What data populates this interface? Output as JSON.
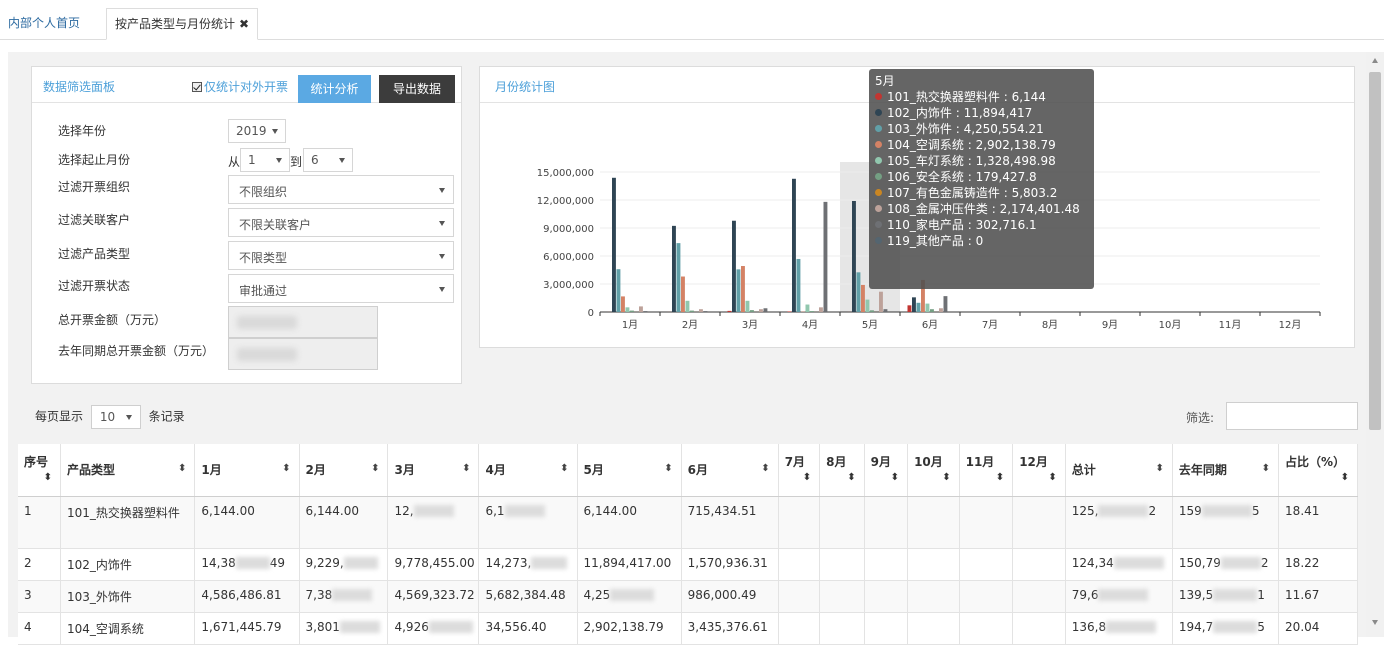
{
  "tabs": [
    {
      "label": "内部个人首页",
      "active": false
    },
    {
      "label": "按产品类型与月份统计",
      "active": true,
      "close_glyph": "✖"
    }
  ],
  "filter_panel": {
    "title": "数据筛选面板",
    "only_external_label": "仅统计对外开票",
    "only_external_checked": true,
    "analyze_button": "统计分析",
    "export_button": "导出数据",
    "labels": {
      "year": "选择年份",
      "month_range": "选择起止月份",
      "org": "过滤开票组织",
      "customer": "过滤关联客户",
      "product_type": "过滤产品类型",
      "status": "过滤开票状态",
      "total": "总开票金额（万元）",
      "last_year": "去年同期总开票金额（万元）"
    },
    "year_value": "2019",
    "month_from_prefix": "从",
    "month_from": "1",
    "month_to_prefix": "到",
    "month_to": "6",
    "org_value": "不限组织",
    "customer_value": "不限关联客户",
    "product_type_value": "不限类型",
    "status_value": "审批通过"
  },
  "chart_panel": {
    "title": "月份统计图"
  },
  "chart_data": {
    "type": "bar",
    "categories": [
      "1月",
      "2月",
      "3月",
      "4月",
      "5月",
      "6月",
      "7月",
      "8月",
      "9月",
      "10月",
      "11月",
      "12月"
    ],
    "series": [
      {
        "name": "101_热交换器塑料件",
        "color": "#c23531",
        "values": [
          6144,
          6144,
          120000,
          61000,
          6144,
          715434.51,
          0,
          0,
          0,
          0,
          0,
          0
        ]
      },
      {
        "name": "102_内饰件",
        "color": "#2f4554",
        "values": [
          14380000,
          9229000,
          9778455,
          14273000,
          11894417,
          1570936.31,
          0,
          0,
          0,
          0,
          0,
          0
        ]
      },
      {
        "name": "103_外饰件",
        "color": "#61a0a8",
        "values": [
          4586486.81,
          7380000,
          4569323.72,
          5682384.48,
          4250554.21,
          986000.49,
          0,
          0,
          0,
          0,
          0,
          0
        ]
      },
      {
        "name": "104_空调系统",
        "color": "#d48265",
        "values": [
          1671445.79,
          3801000,
          4926000,
          34556.4,
          2902138.79,
          3435376.61,
          0,
          0,
          0,
          0,
          0,
          0
        ]
      },
      {
        "name": "105_车灯系统",
        "color": "#91c7ae",
        "values": [
          500000,
          1200000,
          1200000,
          800000,
          1328498.98,
          900000,
          0,
          0,
          0,
          0,
          0,
          0
        ]
      },
      {
        "name": "106_安全系统",
        "color": "#749f83",
        "values": [
          150000,
          150000,
          200000,
          100000,
          179427.8,
          300000,
          0,
          0,
          0,
          0,
          0,
          0
        ]
      },
      {
        "name": "107_有色金属铸造件",
        "color": "#ca8622",
        "values": [
          5000,
          5000,
          5000,
          5000,
          5803.2,
          5000,
          0,
          0,
          0,
          0,
          0,
          0
        ]
      },
      {
        "name": "108_金属冲压件类",
        "color": "#bda29a",
        "values": [
          600000,
          300000,
          300000,
          500000,
          2174401.48,
          400000,
          0,
          0,
          0,
          0,
          0,
          0
        ]
      },
      {
        "name": "110_家电产品",
        "color": "#6e7074",
        "values": [
          100000,
          100000,
          400000,
          11800000,
          302716.1,
          1700000,
          0,
          0,
          0,
          0,
          0,
          0
        ]
      },
      {
        "name": "119_其他产品",
        "color": "#546570",
        "values": [
          0,
          0,
          0,
          0,
          0,
          0,
          0,
          0,
          0,
          0,
          0,
          0
        ]
      }
    ],
    "y_ticks": [
      "0",
      "3,000,000",
      "6,000,000",
      "9,000,000",
      "12,000,000",
      "15,000,000"
    ],
    "ylim": [
      0,
      15000000
    ],
    "grid": true,
    "highlighted_category": "5月",
    "tooltip": {
      "title": "5月",
      "rows": [
        {
          "text": "101_热交换器塑料件 : 6,144",
          "color": "#c23531"
        },
        {
          "text": "102_内饰件 : 11,894,417",
          "color": "#2f4554"
        },
        {
          "text": "103_外饰件 : 4,250,554.21",
          "color": "#61a0a8"
        },
        {
          "text": "104_空调系统 : 2,902,138.79",
          "color": "#d48265"
        },
        {
          "text": "105_车灯系统 : 1,328,498.98",
          "color": "#91c7ae"
        },
        {
          "text": "106_安全系统 : 179,427.8",
          "color": "#749f83"
        },
        {
          "text": "107_有色金属铸造件 : 5,803.2",
          "color": "#ca8622"
        },
        {
          "text": "108_金属冲压件类 : 2,174,401.48",
          "color": "#bda29a"
        },
        {
          "text": "110_家电产品 : 302,716.1",
          "color": "#6e7074"
        },
        {
          "text": "119_其他产品 : 0",
          "color": "#546570"
        }
      ]
    }
  },
  "list_controls": {
    "per_page_prefix": "每页显示",
    "per_page_value": "10",
    "per_page_suffix": "条记录",
    "filter_label": "筛选:"
  },
  "table": {
    "headers": [
      "序号",
      "产品类型",
      "1月",
      "2月",
      "3月",
      "4月",
      "5月",
      "6月",
      "7月",
      "8月",
      "9月",
      "10月",
      "11月",
      "12月",
      "总计",
      "去年同期",
      "占比（%）"
    ],
    "rows": [
      {
        "idx": "1",
        "type": "101_热交换器塑料件",
        "m1": "6,144.00",
        "m2": "6,144.00",
        "m3": "12,",
        "m4": "6,1",
        "m5": "6,144.00",
        "m6": "715,434.51",
        "total": "125,",
        "total_tail": "2",
        "last": "159",
        "last_tail": "5",
        "pct": "18.41"
      },
      {
        "idx": "2",
        "type": "102_内饰件",
        "m1": "14,38",
        "m1_tail": "49",
        "m2": "9,229,",
        "m3": "9,778,455.00",
        "m4": "14,273,",
        "m5": "11,894,417.00",
        "m6": "1,570,936.31",
        "total": "124,34",
        "total_tail": "",
        "last": "150,79",
        "last_tail": "2",
        "pct": "18.22"
      },
      {
        "idx": "3",
        "type": "103_外饰件",
        "m1": "4,586,486.81",
        "m2": "7,38",
        "m3": "4,569,323.72",
        "m4": "5,682,384.48",
        "m5": "4,25",
        "m6": "986,000.49",
        "total": "79,6",
        "total_tail": "",
        "last": "139,5",
        "last_tail": "1",
        "pct": "11.67"
      },
      {
        "idx": "4",
        "type": "104_空调系统",
        "m1": "1,671,445.79",
        "m2": "3,801",
        "m3": "4,926",
        "m4": "34,556.40",
        "m5": "2,902,138.79",
        "m6": "3,435,376.61",
        "total": "136,8",
        "total_tail": "",
        "last": "194,7",
        "last_tail": "5",
        "pct": "20.04"
      }
    ]
  }
}
